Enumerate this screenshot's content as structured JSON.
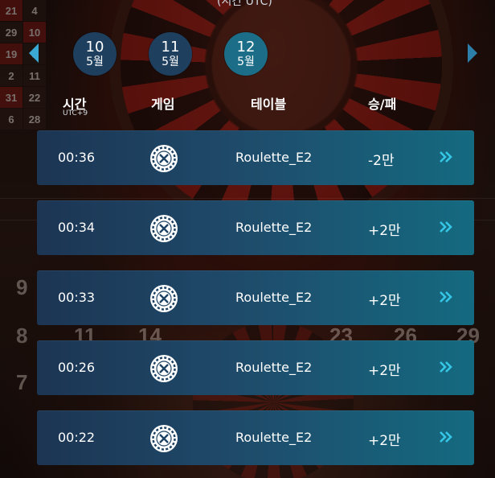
{
  "header": {
    "caption": "(시간 UTC)"
  },
  "dates": [
    {
      "day": "10",
      "month": "5월",
      "active": false
    },
    {
      "day": "11",
      "month": "5월",
      "active": false
    },
    {
      "day": "12",
      "month": "5월",
      "active": true
    }
  ],
  "columns": {
    "time": "시간",
    "time_zone": "UTC+9",
    "game": "게임",
    "table": "테이블",
    "result": "승/패"
  },
  "rows": [
    {
      "time": "00:36",
      "game_icon": "roulette-icon",
      "table": "Roulette_E2",
      "result": "-2만"
    },
    {
      "time": "00:34",
      "game_icon": "roulette-icon",
      "table": "Roulette_E2",
      "result": "+2만"
    },
    {
      "time": "00:33",
      "game_icon": "roulette-icon",
      "table": "Roulette_E2",
      "result": "+2만"
    },
    {
      "time": "00:26",
      "game_icon": "roulette-icon",
      "table": "Roulette_E2",
      "result": "+2만"
    },
    {
      "time": "00:22",
      "game_icon": "roulette-icon",
      "table": "Roulette_E2",
      "result": "+2만"
    }
  ],
  "colors": {
    "row_start": "#1c3553",
    "row_end": "#146a80",
    "active_date": "#1c6e88",
    "inactive_date": "#1e3f5e",
    "chevron": "#35c6e6"
  }
}
